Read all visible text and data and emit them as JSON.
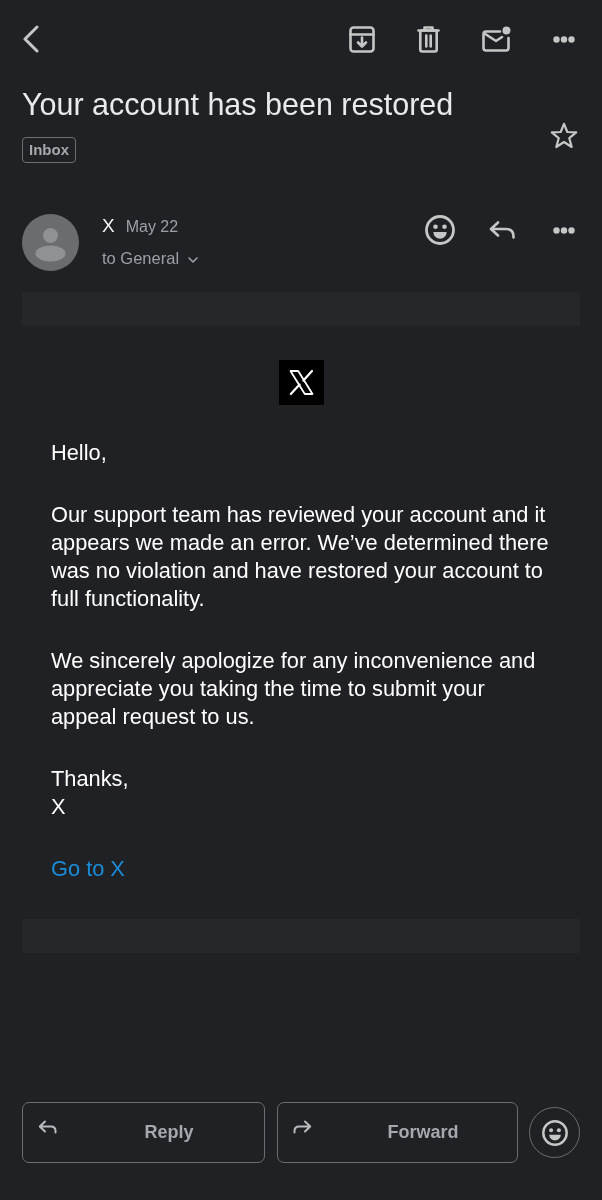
{
  "message": {
    "subject": "Your account has been restored",
    "labels": [
      "Inbox"
    ],
    "starred": false
  },
  "sender": {
    "name": "X",
    "date": "May 22",
    "recipients": "to General",
    "details_expanded": false
  },
  "email": {
    "paragraphs": [
      "Hello,",
      "Our support team has reviewed your account and it appears we made an error. We’ve determined there was no violation and have restored your account to full functionality.",
      "We sincerely apologize for any inconvenience and appreciate you taking the time to submit your appeal request to us.",
      "Thanks,\nX"
    ],
    "link": "Go to X"
  },
  "reply_bar": {
    "buttons": [
      {
        "kind": "reply",
        "label": "Reply"
      },
      {
        "kind": "forward",
        "label": "Forward"
      }
    ]
  }
}
